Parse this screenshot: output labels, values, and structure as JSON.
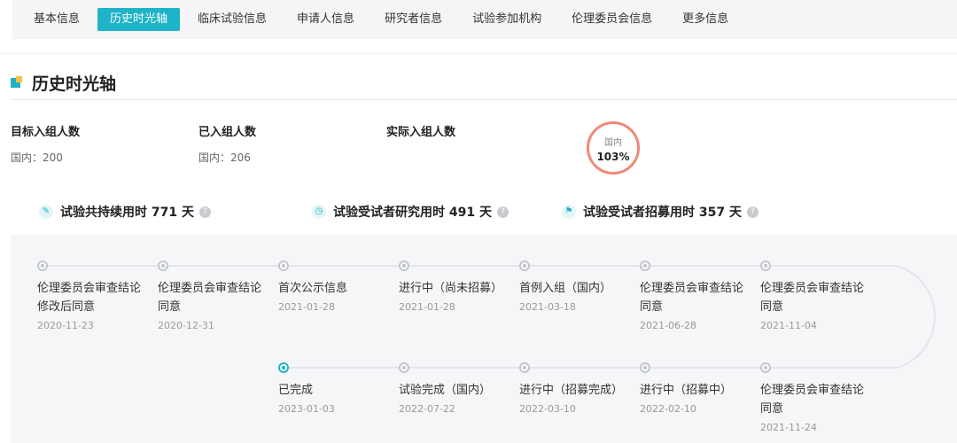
{
  "tabs": [
    {
      "label": "基本信息",
      "active": false
    },
    {
      "label": "历史时光轴",
      "active": true
    },
    {
      "label": "临床试验信息",
      "active": false
    },
    {
      "label": "申请人信息",
      "active": false
    },
    {
      "label": "研究者信息",
      "active": false
    },
    {
      "label": "试验参加机构",
      "active": false
    },
    {
      "label": "伦理委员会信息",
      "active": false
    },
    {
      "label": "更多信息",
      "active": false
    }
  ],
  "section": {
    "title": "历史时光轴"
  },
  "stats": {
    "target": {
      "label": "目标入组人数",
      "value": "国内：200"
    },
    "enrolled": {
      "label": "已入组人数",
      "value": "国内：206"
    },
    "actual": {
      "label": "实际入组人数",
      "value": ""
    },
    "ratio": {
      "label": "国内",
      "value": "103%"
    }
  },
  "durations": [
    {
      "icon": "pen-icon",
      "text": "试验共持续用时 771 天"
    },
    {
      "icon": "clock-icon",
      "text": "试验受试者研究用时 491 天"
    },
    {
      "icon": "flag-icon",
      "text": "试验受试者招募用时 357 天"
    }
  ],
  "timeline": {
    "row1": [
      {
        "event": "伦理委员会审查结论修改后同意",
        "date": "2020-11-23"
      },
      {
        "event": "伦理委员会审查结论同意",
        "date": "2020-12-31"
      },
      {
        "event": "首次公示信息",
        "date": "2021-01-28"
      },
      {
        "event": "进行中（尚未招募）",
        "date": "2021-01-28"
      },
      {
        "event": "首例入组（国内）",
        "date": "2021-03-18"
      },
      {
        "event": "伦理委员会审查结论同意",
        "date": "2021-06-28"
      },
      {
        "event": "伦理委员会审查结论同意",
        "date": "2021-11-04"
      }
    ],
    "row2": [
      {
        "event": "已完成",
        "date": "2023-01-03",
        "current": true
      },
      {
        "event": "试验完成（国内）",
        "date": "2022-07-22"
      },
      {
        "event": "进行中（招募完成）",
        "date": "2022-03-10"
      },
      {
        "event": "进行中（招募中）",
        "date": "2022-02-10"
      },
      {
        "event": "伦理委员会审查结论同意",
        "date": "2021-11-24"
      }
    ]
  },
  "colors": {
    "accent": "#1fb3c7",
    "ring": "#ee8a78",
    "node": "#c3c6cb"
  }
}
